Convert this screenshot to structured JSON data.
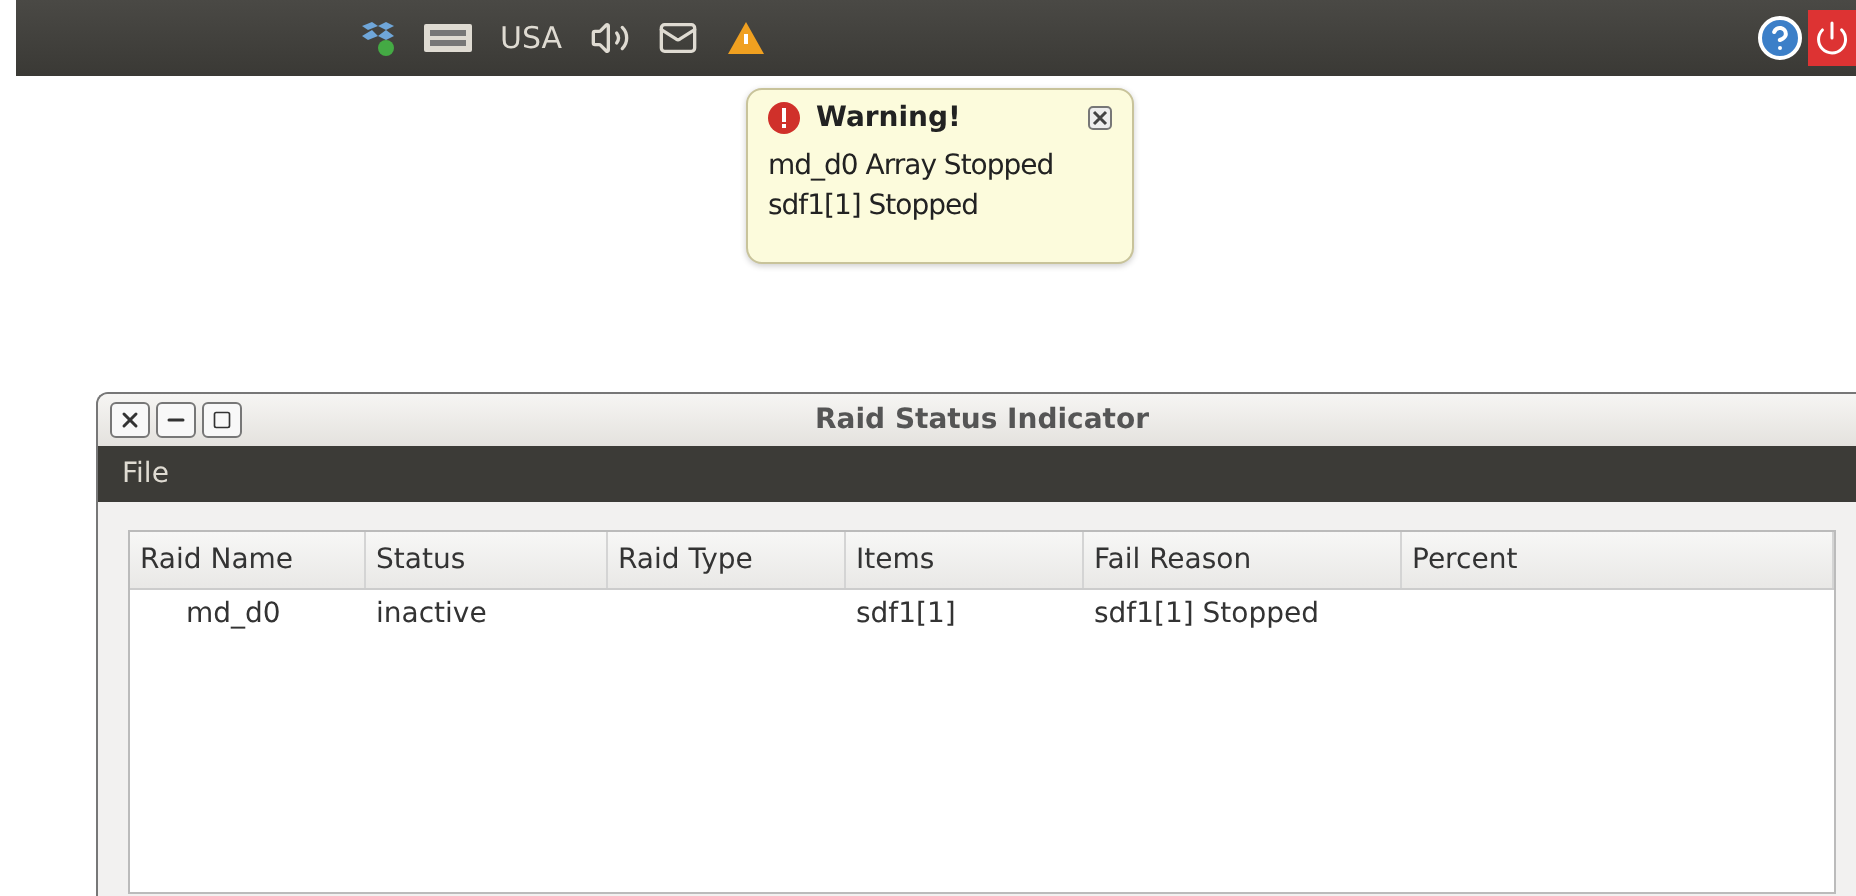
{
  "top_panel": {
    "keyboard_layout": "USA"
  },
  "notification": {
    "title": "Warning!",
    "lines": [
      "md_d0 Array Stopped",
      "sdf1[1] Stopped"
    ]
  },
  "window": {
    "title": "Raid Status Indicator",
    "menu": [
      "File"
    ],
    "table": {
      "columns": [
        "Raid Name",
        "Status",
        "Raid Type",
        "Items",
        "Fail Reason",
        "Percent"
      ],
      "rows": [
        [
          "md_d0",
          "inactive",
          "",
          "sdf1[1]",
          "sdf1[1] Stopped",
          ""
        ]
      ]
    }
  }
}
